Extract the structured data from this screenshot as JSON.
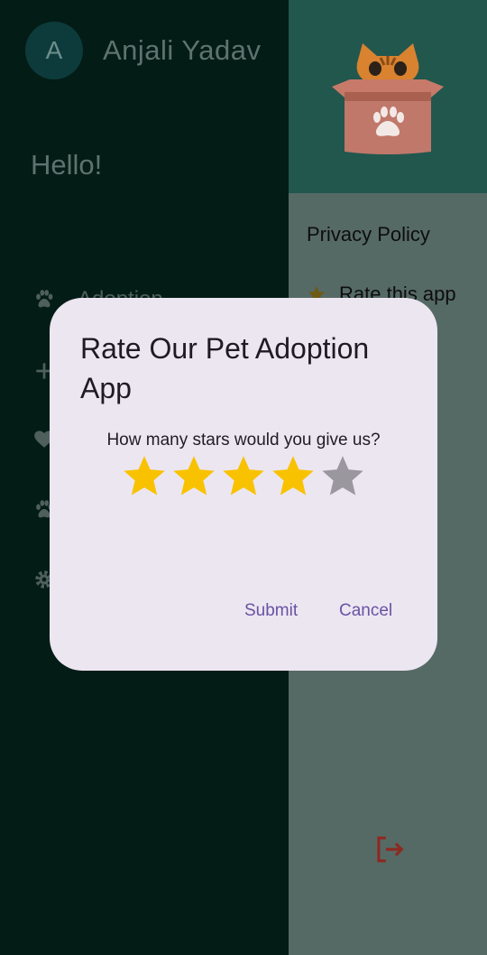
{
  "drawer": {
    "avatar_initial": "A",
    "user_name": "Anjali Yadav",
    "greeting": "Hello!",
    "nav_items": [
      {
        "label": "Adoption",
        "icon": "paw-icon"
      },
      {
        "label": "",
        "icon": "plus-icon"
      },
      {
        "label": "",
        "icon": "heart-icon"
      },
      {
        "label": "",
        "icon": "paw-icon"
      },
      {
        "label": "",
        "icon": "gear-icon"
      }
    ]
  },
  "main": {
    "privacy_label": "Privacy Policy",
    "rate_label": "Rate this app"
  },
  "dialog": {
    "title": "Rate Our Pet Adoption App",
    "question": "How many stars would you give us?",
    "rating": 4,
    "max_rating": 5,
    "submit_label": "Submit",
    "cancel_label": "Cancel"
  },
  "colors": {
    "star_active": "#f9c200",
    "star_inactive": "#9b979f",
    "accent": "#6a52a3"
  }
}
